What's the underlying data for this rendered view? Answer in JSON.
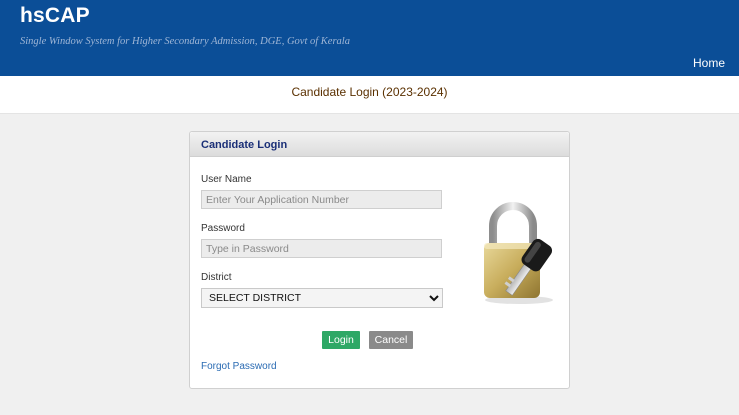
{
  "header": {
    "brand": "hsCAP",
    "tagline": "Single Window System for Higher Secondary Admission, DGE, Govt of Kerala",
    "home_label": "Home"
  },
  "page": {
    "title": "Candidate Login (2023-2024)"
  },
  "login_card": {
    "title": "Candidate Login",
    "username_label": "User Name",
    "username_placeholder": "Enter Your Application Number",
    "username_value": "",
    "password_label": "Password",
    "password_placeholder": "Type in Password",
    "password_value": "",
    "district_label": "District",
    "district_selected": "SELECT DISTRICT",
    "login_button": "Login",
    "cancel_button": "Cancel",
    "forgot_password": "Forgot Password",
    "illustration": "padlock-and-key-icon"
  },
  "colors": {
    "header_bg": "#0b4e97",
    "title_color": "#5a3000",
    "card_title_color": "#1a2f77",
    "login_button_bg": "#2ea866",
    "cancel_button_bg": "#8a8a8a",
    "link_color": "#2a6bb3"
  }
}
